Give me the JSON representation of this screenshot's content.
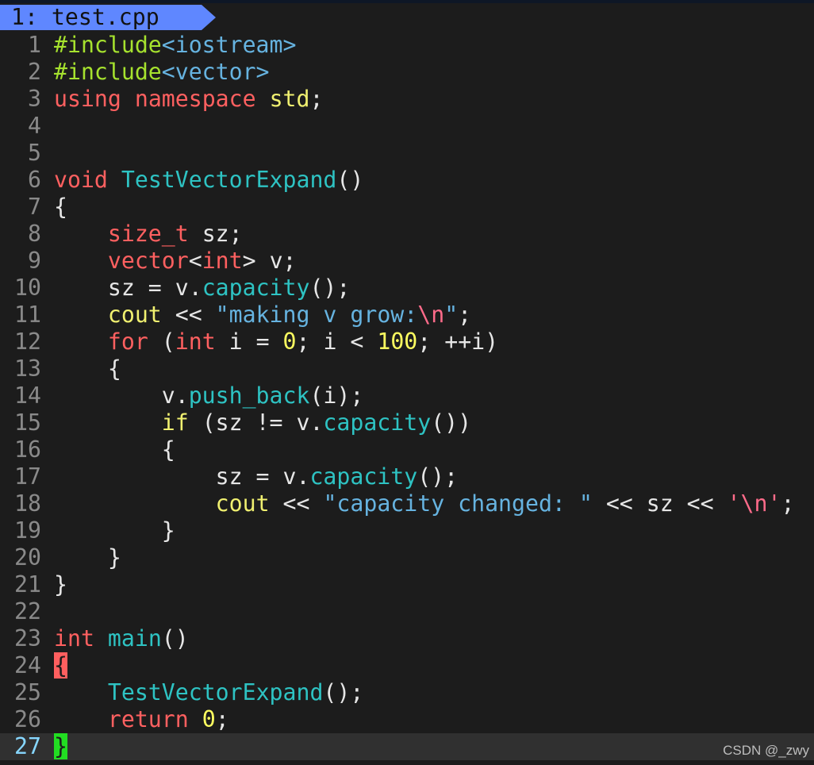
{
  "tab": {
    "label": "1: test.cpp"
  },
  "lines": [
    {
      "n": "1",
      "parts": [
        [
          "pp",
          "#include"
        ],
        [
          "str",
          "<iostream>"
        ]
      ]
    },
    {
      "n": "2",
      "parts": [
        [
          "pp",
          "#include"
        ],
        [
          "str",
          "<vector>"
        ]
      ]
    },
    {
      "n": "3",
      "parts": [
        [
          "kw",
          "using"
        ],
        [
          "plain",
          " "
        ],
        [
          "kw",
          "namespace"
        ],
        [
          "plain",
          " "
        ],
        [
          "yl",
          "std"
        ],
        [
          "plain",
          ";"
        ]
      ]
    },
    {
      "n": "4",
      "parts": []
    },
    {
      "n": "5",
      "parts": []
    },
    {
      "n": "6",
      "parts": [
        [
          "kw",
          "void"
        ],
        [
          "plain",
          " "
        ],
        [
          "fn",
          "TestVectorExpand"
        ],
        [
          "plain",
          "()"
        ]
      ]
    },
    {
      "n": "7",
      "parts": [
        [
          "plain",
          "{"
        ]
      ]
    },
    {
      "n": "8",
      "parts": [
        [
          "plain",
          "    "
        ],
        [
          "kw",
          "size_t"
        ],
        [
          "plain",
          " sz;"
        ]
      ]
    },
    {
      "n": "9",
      "parts": [
        [
          "plain",
          "    "
        ],
        [
          "kw",
          "vector"
        ],
        [
          "plain",
          "<"
        ],
        [
          "kw",
          "int"
        ],
        [
          "plain",
          "> v;"
        ]
      ]
    },
    {
      "n": "10",
      "parts": [
        [
          "plain",
          "    sz = v."
        ],
        [
          "fn",
          "capacity"
        ],
        [
          "plain",
          "();"
        ]
      ]
    },
    {
      "n": "11",
      "parts": [
        [
          "plain",
          "    "
        ],
        [
          "yl",
          "cout"
        ],
        [
          "plain",
          " << "
        ],
        [
          "str",
          "\"making v grow:"
        ],
        [
          "esc",
          "\\n"
        ],
        [
          "str",
          "\""
        ],
        [
          "plain",
          ";"
        ]
      ]
    },
    {
      "n": "12",
      "parts": [
        [
          "plain",
          "    "
        ],
        [
          "kw",
          "for"
        ],
        [
          "plain",
          " ("
        ],
        [
          "kw",
          "int"
        ],
        [
          "plain",
          " i = "
        ],
        [
          "num",
          "0"
        ],
        [
          "plain",
          "; i < "
        ],
        [
          "num",
          "100"
        ],
        [
          "plain",
          "; ++i)"
        ]
      ]
    },
    {
      "n": "13",
      "parts": [
        [
          "plain",
          "    {"
        ]
      ]
    },
    {
      "n": "14",
      "parts": [
        [
          "plain",
          "        v."
        ],
        [
          "fn",
          "push_back"
        ],
        [
          "plain",
          "(i);"
        ]
      ]
    },
    {
      "n": "15",
      "parts": [
        [
          "plain",
          "        "
        ],
        [
          "yl",
          "if"
        ],
        [
          "plain",
          " (sz != v."
        ],
        [
          "fn",
          "capacity"
        ],
        [
          "plain",
          "())"
        ]
      ]
    },
    {
      "n": "16",
      "parts": [
        [
          "plain",
          "        {"
        ]
      ]
    },
    {
      "n": "17",
      "parts": [
        [
          "plain",
          "            sz = v."
        ],
        [
          "fn",
          "capacity"
        ],
        [
          "plain",
          "();"
        ]
      ]
    },
    {
      "n": "18",
      "parts": [
        [
          "plain",
          "            "
        ],
        [
          "yl",
          "cout"
        ],
        [
          "plain",
          " << "
        ],
        [
          "str",
          "\"capacity changed: \""
        ],
        [
          "plain",
          " << sz << "
        ],
        [
          "esc",
          "'\\n'"
        ],
        [
          "plain",
          ";"
        ]
      ]
    },
    {
      "n": "19",
      "parts": [
        [
          "plain",
          "        }"
        ]
      ]
    },
    {
      "n": "20",
      "parts": [
        [
          "plain",
          "    }"
        ]
      ]
    },
    {
      "n": "21",
      "parts": [
        [
          "plain",
          "}"
        ]
      ]
    },
    {
      "n": "22",
      "parts": []
    },
    {
      "n": "23",
      "parts": [
        [
          "kw",
          "int"
        ],
        [
          "plain",
          " "
        ],
        [
          "fn",
          "main"
        ],
        [
          "plain",
          "()"
        ]
      ]
    },
    {
      "n": "24",
      "parts": [
        [
          "brace-red",
          "{"
        ]
      ]
    },
    {
      "n": "25",
      "parts": [
        [
          "plain",
          "    "
        ],
        [
          "fn",
          "TestVectorExpand"
        ],
        [
          "plain",
          "();"
        ]
      ]
    },
    {
      "n": "26",
      "parts": [
        [
          "plain",
          "    "
        ],
        [
          "kw",
          "return"
        ],
        [
          "plain",
          " "
        ],
        [
          "num",
          "0"
        ],
        [
          "plain",
          ";"
        ]
      ]
    },
    {
      "n": "27",
      "current": true,
      "parts": [
        [
          "brace-green",
          "}"
        ]
      ]
    }
  ],
  "watermark": "CSDN @_zwy"
}
